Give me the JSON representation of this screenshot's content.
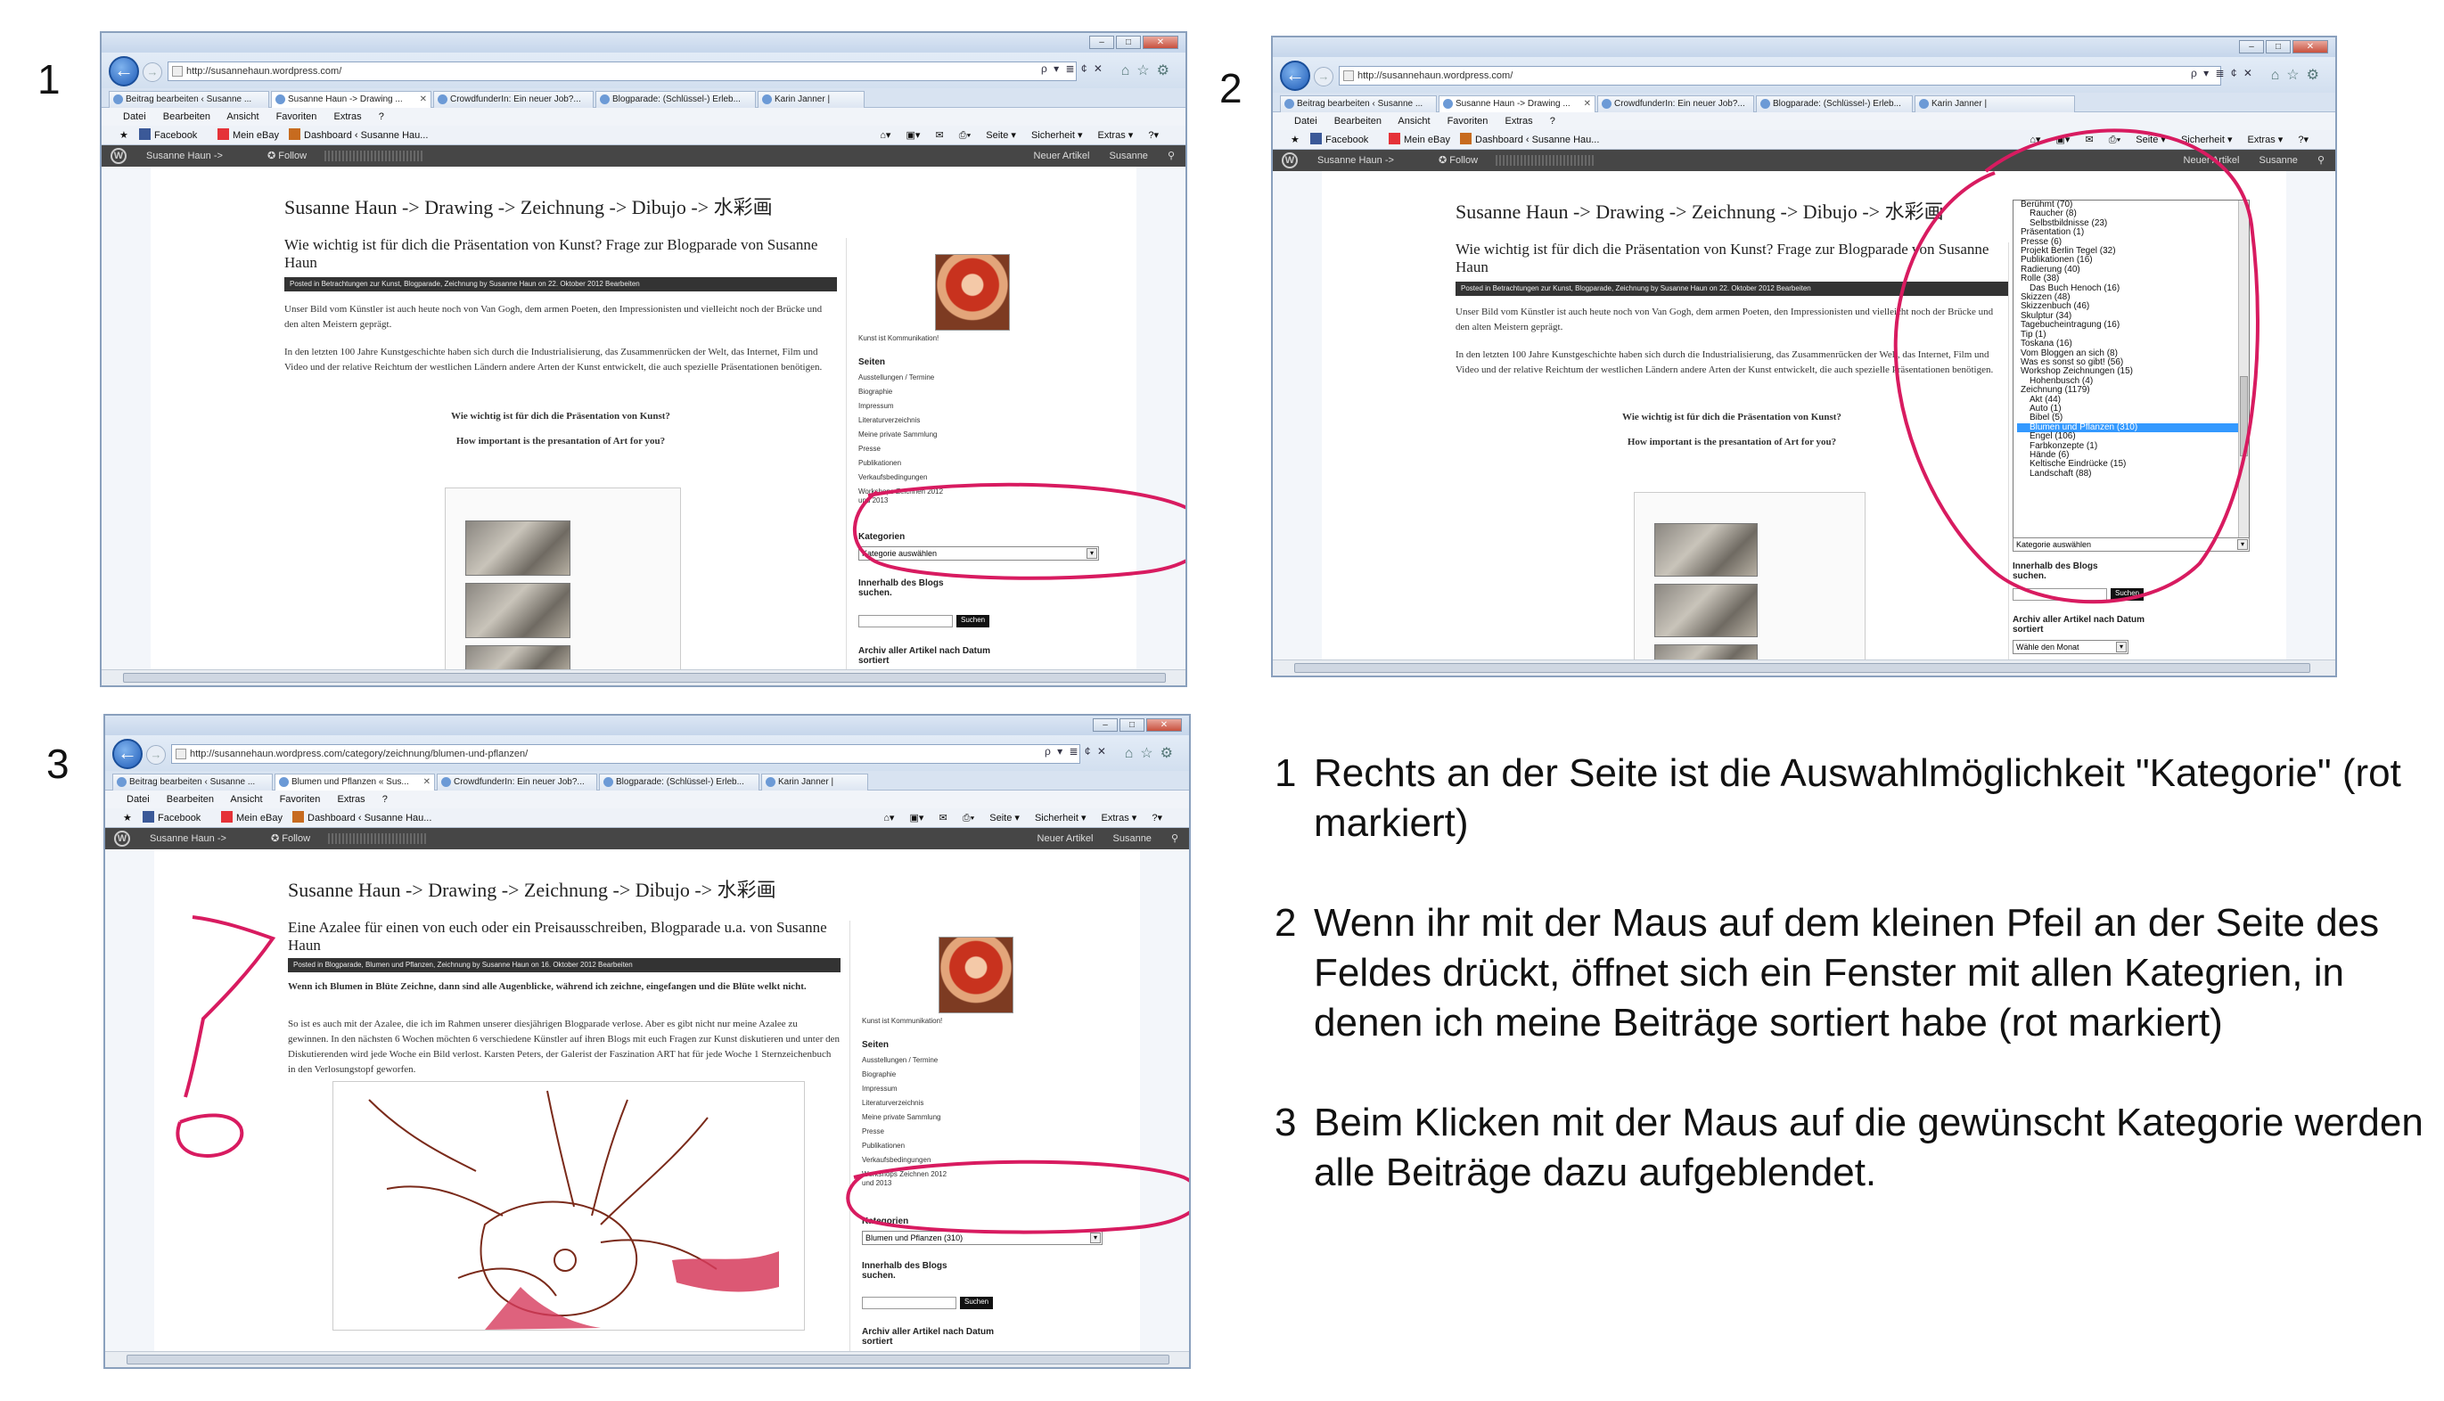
{
  "panels": [
    {
      "number": "1",
      "url": "http://susannehaun.wordpress.com/",
      "tabs": [
        "Beitrag bearbeiten ‹ Susanne ...",
        "Susanne Haun -> Drawing ...",
        "CrowdfunderIn: Ein neuer Job?...",
        "Blogparade: (Schlüssel-) Erleb...",
        "Karin Janner |"
      ],
      "blog_title": "Susanne Haun -> Drawing -> Zeichnung -> Dibujo -> 水彩画",
      "post_title": "Wie wichtig ist für dich die Präsentation von Kunst? Frage zur Blogparade von Susanne Haun",
      "post_meta": "Posted in Betrachtungen zur Kunst, Blogparade, Zeichnung by Susanne Haun on 22. Oktober 2012 Bearbeiten",
      "paragraphs": [
        "Unser Bild vom Künstler ist auch heute noch von Van Gogh, dem armen Poeten, den Impressionisten und vielleicht noch der Brücke und den alten Meistern geprägt.",
        "In den letzten 100 Jahre Kunstgeschichte haben sich durch die Industrialisierung, das Zusammenrücken der Welt, das Internet, Film und Video und der relative Reichtum der westlichen Ländern andere Arten der Kunst entwickelt, die auch spezielle Präsentationen benötigen."
      ],
      "question_de": "Wie wichtig ist für dich die Präsentation von Kunst?",
      "question_en": "How important is the presantation of Art for you?",
      "category_value": "Kategorie auswählen"
    },
    {
      "number": "2",
      "url": "http://susannehaun.wordpress.com/",
      "tabs": [
        "Beitrag bearbeiten ‹ Susanne ...",
        "Susanne Haun -> Drawing ...",
        "CrowdfunderIn: Ein neuer Job?...",
        "Blogparade: (Schlüssel-) Erleb...",
        "Karin Janner |"
      ],
      "blog_title": "Susanne Haun -> Drawing -> Zeichnung -> Dibujo -> 水彩画",
      "post_title": "Wie wichtig ist für dich die Präsentation von Kunst? Frage zur Blogparade von Susanne Haun",
      "post_meta": "Posted in Betrachtungen zur Kunst, Blogparade, Zeichnung by Susanne Haun on 22. Oktober 2012 Bearbeiten",
      "paragraphs": [
        "Unser Bild vom Künstler ist auch heute noch von Van Gogh, dem armen Poeten, den Impressionisten und vielleicht noch der Brücke und den alten Meistern geprägt.",
        "In den letzten 100 Jahre Kunstgeschichte haben sich durch die Industrialisierung, das Zusammenrücken der Welt, das Internet, Film und Video und der relative Reichtum der westlichen Ländern andere Arten der Kunst entwickelt, die auch spezielle Präsentationen benötigen."
      ],
      "question_de": "Wie wichtig ist für dich die Präsentation von Kunst?",
      "question_en": "How important is the presantation of Art for you?",
      "category_value": "Kategorie auswählen",
      "dropdown_options": [
        {
          "label": "Berühmt  (70)",
          "indent": false,
          "selected": false
        },
        {
          "label": "Raucher  (8)",
          "indent": true,
          "selected": false
        },
        {
          "label": "Selbstbildnisse  (23)",
          "indent": true,
          "selected": false
        },
        {
          "label": "Präsentation  (1)",
          "indent": false,
          "selected": false
        },
        {
          "label": "Presse  (6)",
          "indent": false,
          "selected": false
        },
        {
          "label": "Projekt Berlin Tegel  (32)",
          "indent": false,
          "selected": false
        },
        {
          "label": "Publikationen  (16)",
          "indent": false,
          "selected": false
        },
        {
          "label": "Radierung  (40)",
          "indent": false,
          "selected": false
        },
        {
          "label": "Rolle  (38)",
          "indent": false,
          "selected": false
        },
        {
          "label": "Das Buch Henoch  (16)",
          "indent": true,
          "selected": false
        },
        {
          "label": "Skizzen  (48)",
          "indent": false,
          "selected": false
        },
        {
          "label": "Skizzenbuch  (46)",
          "indent": false,
          "selected": false
        },
        {
          "label": "Skulptur  (34)",
          "indent": false,
          "selected": false
        },
        {
          "label": "Tagebucheintragung  (16)",
          "indent": false,
          "selected": false
        },
        {
          "label": "Tip  (1)",
          "indent": false,
          "selected": false
        },
        {
          "label": "Toskana  (16)",
          "indent": false,
          "selected": false
        },
        {
          "label": "Vom Bloggen an sich  (8)",
          "indent": false,
          "selected": false
        },
        {
          "label": "Was es sonst so gibt!  (56)",
          "indent": false,
          "selected": false
        },
        {
          "label": "Workshop Zeichnungen  (15)",
          "indent": false,
          "selected": false
        },
        {
          "label": "Hohenbusch  (4)",
          "indent": true,
          "selected": false
        },
        {
          "label": "Zeichnung  (1179)",
          "indent": false,
          "selected": false
        },
        {
          "label": "Akt  (44)",
          "indent": true,
          "selected": false
        },
        {
          "label": "Auto  (1)",
          "indent": true,
          "selected": false
        },
        {
          "label": "Bibel  (5)",
          "indent": true,
          "selected": false
        },
        {
          "label": "Blumen und Pflanzen  (310)",
          "indent": true,
          "selected": true
        },
        {
          "label": "Engel  (106)",
          "indent": true,
          "selected": false
        },
        {
          "label": "Farbkonzepte  (1)",
          "indent": true,
          "selected": false
        },
        {
          "label": "Hände  (6)",
          "indent": true,
          "selected": false
        },
        {
          "label": "Keltische Eindrücke  (15)",
          "indent": true,
          "selected": false
        },
        {
          "label": "Landschaft  (88)",
          "indent": true,
          "selected": false
        }
      ]
    },
    {
      "number": "3",
      "url": "http://susannehaun.wordpress.com/category/zeichnung/blumen-und-pflanzen/",
      "tabs": [
        "Beitrag bearbeiten ‹ Susanne ...",
        "Blumen und Pflanzen « Sus...",
        "CrowdfunderIn: Ein neuer Job?...",
        "Blogparade: (Schlüssel-) Erleb...",
        "Karin Janner |"
      ],
      "blog_title": "Susanne Haun -> Drawing -> Zeichnung -> Dibujo -> 水彩画",
      "post_title": "Eine Azalee für einen von euch oder ein Preisausschreiben, Blogparade u.a. von Susanne Haun",
      "post_meta": "Posted in Blogparade, Blumen und Pflanzen, Zeichnung by Susanne Haun on 16. Oktober 2012 Bearbeiten",
      "lead": "Wenn ich Blumen in Blüte Zeichne, dann sind alle Augenblicke, während ich zeichne, eingefangen und die Blüte welkt nicht.",
      "paragraphs": [
        "So ist es auch mit der Azalee, die ich im Rahmen unserer diesjährigen Blogparade verlose. Aber es gibt nicht nur meine Azalee zu gewinnen. In den nächsten 6 Wochen möchten 6 verschiedene Künstler auf ihren Blogs mit euch Fragen zur Kunst diskutieren und unter den Diskutierenden wird jede Woche ein Bild verlost. Karsten Peters, der Galerist der Faszination ART hat für jede Woche 1 Sternzeichenbuch in den Verlosungstopf geworfen."
      ],
      "category_value": "Blumen und Pflanzen  (310)"
    }
  ],
  "browser": {
    "menu": [
      "Datei",
      "Bearbeiten",
      "Ansicht",
      "Favoriten",
      "Extras",
      "?"
    ],
    "favorites": [
      "Facebook",
      "Mein eBay",
      "Dashboard ‹ Susanne Hau..."
    ],
    "page_tools": [
      "Seite ▾",
      "Sicherheit ▾",
      "Extras ▾"
    ],
    "wp_site": "Susanne Haun ->",
    "wp_follow": "✪ Follow",
    "wp_new": "Neuer Artikel",
    "wp_user": "Susanne",
    "addr_tools": "ρ ▾ ≣ ¢ ✕"
  },
  "sidebar": {
    "caption": "Kunst ist Kommunikation!",
    "pages_heading": "Seiten",
    "pages": [
      "Ausstellungen / Termine",
      "Biographie",
      "Impressum",
      "Literaturverzeichnis",
      "Meine private Sammlung",
      "Presse",
      "Publikationen",
      "Verkaufsbedingungen",
      "Workshops Zeichnen 2012",
      "und 2013"
    ],
    "categories_heading": "Kategorien",
    "categories_heading_short": "Kategorie",
    "search_heading": "Innerhalb des Blogs suchen.",
    "search_button": "Suchen",
    "archive_heading": "Archiv aller Artikel nach Datum sortiert",
    "archive_value": "Wähle den Monat"
  },
  "instructions": [
    {
      "num": "1",
      "text": "Rechts an der Seite ist die Auswahlmöglichkeit \"Kategorie\" (rot markiert)"
    },
    {
      "num": "2",
      "text": "Wenn ihr mit der Maus auf dem kleinen Pfeil an der Seite des Feldes drückt, öffnet sich ein Fenster mit allen Kategrien, in denen ich meine Beiträge sortiert habe (rot markiert)"
    },
    {
      "num": "3",
      "text": "Beim Klicken mit der Maus auf die gewünscht Kategorie werden alle Beiträge dazu aufgeblendet."
    }
  ],
  "colors": {
    "annotation_red": "#d81b60",
    "selection_blue": "#3399ff",
    "wp_admin_bar": "#464646"
  }
}
